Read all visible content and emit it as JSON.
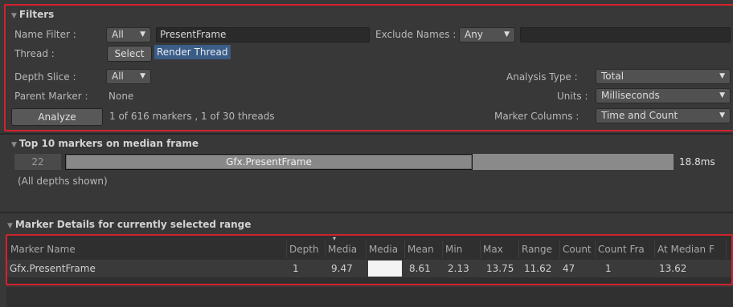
{
  "filters": {
    "title": "Filters",
    "name_filter_label": "Name Filter :",
    "name_filter_mode": "All",
    "name_filter_value": "PresentFrame",
    "exclude_names_label": "Exclude Names :",
    "exclude_names_mode": "Any",
    "exclude_names_value": "",
    "thread_label": "Thread :",
    "thread_select_button": "Select",
    "thread_value": "Render Thread",
    "depth_slice_label": "Depth Slice :",
    "depth_slice_value": "All",
    "parent_marker_label": "Parent Marker :",
    "parent_marker_value": "None",
    "analysis_type_label": "Analysis Type :",
    "analysis_type_value": "Total",
    "units_label": "Units :",
    "units_value": "Milliseconds",
    "marker_columns_label": "Marker Columns :",
    "marker_columns_value": "Time and Count",
    "analyze_button": "Analyze",
    "summary": "1 of 616 markers ,  1 of 30 threads"
  },
  "top_markers": {
    "title": "Top 10 markers on median frame",
    "rank": "22",
    "bar_label": "Gfx.PresentFrame",
    "bar_fraction": 0.67,
    "total_time": "18.8ms",
    "depth_note": "(All depths shown)"
  },
  "marker_details": {
    "title": "Marker Details for currently selected range",
    "columns": [
      "Marker Name",
      "Depth",
      "Media",
      "Media",
      "Mean",
      "Min",
      "Max",
      "Range",
      "Count",
      "Count Fra",
      "At Median F"
    ],
    "sort_indicator": "▾",
    "row": {
      "name": "Gfx.PresentFrame",
      "depth": "1",
      "median": "9.47",
      "median_bar": "",
      "mean": "8.61",
      "min": "2.13",
      "max": "13.75",
      "range": "11.62",
      "count": "47",
      "count_frame": "1",
      "at_median_frame": "13.62"
    }
  },
  "colors": {
    "highlight_outline": "#d3222c",
    "selection_blue": "#3a5c86",
    "panel_bg": "#383838"
  }
}
